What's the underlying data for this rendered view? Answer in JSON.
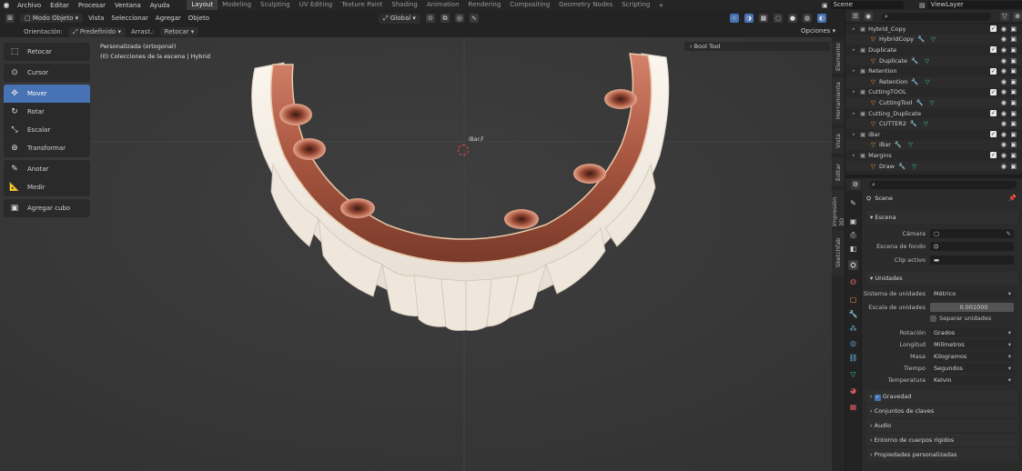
{
  "topbar": {
    "menus": [
      "Archivo",
      "Editar",
      "Procesar",
      "Ventana",
      "Ayuda"
    ],
    "workspaces": [
      "Layout",
      "Modeling",
      "Sculpting",
      "UV Editing",
      "Texture Paint",
      "Shading",
      "Animation",
      "Rendering",
      "Compositing",
      "Geometry Nodes",
      "Scripting"
    ],
    "active_workspace": "Layout",
    "scene_label": "Scene",
    "viewlayer_label": "ViewLayer"
  },
  "viewport_header": {
    "mode": "Modo Objeto",
    "menus": [
      "Vista",
      "Seleccionar",
      "Agregar",
      "Objeto"
    ],
    "transform_orientation": "Global",
    "options_label": "Opciones"
  },
  "tool_settings": {
    "orientation_label": "Orientación:",
    "orientation_value": "Predefinido",
    "drag_label": "Arrast.:",
    "drag_value": "Retocar"
  },
  "toolbar": [
    {
      "label": "Retocar",
      "icon": "tweak-icon",
      "active": false
    },
    {
      "label": "Cursor",
      "icon": "cursor-icon",
      "active": false
    },
    {
      "label": "Mover",
      "icon": "move-icon",
      "active": true
    },
    {
      "label": "Rotar",
      "icon": "rotate-icon",
      "active": false
    },
    {
      "label": "Escalar",
      "icon": "scale-icon",
      "active": false
    },
    {
      "label": "Transformar",
      "icon": "transform-icon",
      "active": false
    },
    {
      "label": "Anotar",
      "icon": "annotate-icon",
      "active": false
    },
    {
      "label": "Medir",
      "icon": "measure-icon",
      "active": false
    },
    {
      "label": "Agregar cubo",
      "icon": "add-cube-icon",
      "active": false
    }
  ],
  "viewport": {
    "info_line1": "Personalizada (ortogonal)",
    "info_line2": "(0) Colecciones de la escena | Hybrid",
    "panel_label": "Bool Tool",
    "object_label": "iBar.F"
  },
  "side_tabs": [
    "Elemento",
    "Herramienta",
    "Vista",
    "Editar",
    "Impresión 3D",
    "Sketchfab"
  ],
  "outliner": [
    {
      "name": "Hybrid_Copy",
      "type": "object",
      "indent": 1
    },
    {
      "name": "HybridCopy",
      "type": "mesh",
      "indent": 2
    },
    {
      "name": "Duplicate",
      "type": "object",
      "indent": 1
    },
    {
      "name": "Duplicate",
      "type": "mesh",
      "indent": 2
    },
    {
      "name": "Retention",
      "type": "object",
      "indent": 1
    },
    {
      "name": "Retention",
      "type": "mesh",
      "indent": 2
    },
    {
      "name": "CuttingTOOL",
      "type": "object",
      "indent": 1
    },
    {
      "name": "CuttingTool",
      "type": "mesh",
      "indent": 2
    },
    {
      "name": "Cutting_Duplicate",
      "type": "object",
      "indent": 1
    },
    {
      "name": "CUTTER2",
      "type": "mesh",
      "indent": 2
    },
    {
      "name": "iBar",
      "type": "object",
      "indent": 1
    },
    {
      "name": "iBar",
      "type": "mesh",
      "indent": 2
    },
    {
      "name": "Margins",
      "type": "object",
      "indent": 1
    },
    {
      "name": "Draw",
      "type": "mesh",
      "indent": 2
    }
  ],
  "properties": {
    "context": "Scene",
    "scene_section": "Escena",
    "camera_label": "Cámara",
    "background_label": "Escena de fondo",
    "clip_label": "Clip activo",
    "units_section": "Unidades",
    "unit_system_label": "Sistema de unidades",
    "unit_system_value": "Métrico",
    "unit_scale_label": "Escala de unidades",
    "unit_scale_value": "0.001000",
    "separate_units_label": "Separar unidades",
    "rotation_label": "Rotación",
    "rotation_value": "Grados",
    "length_label": "Longitud",
    "length_value": "Milímetros",
    "mass_label": "Masa",
    "mass_value": "Kilogramos",
    "time_label": "Tiempo",
    "time_value": "Segundos",
    "temperature_label": "Temperatura",
    "temperature_value": "Kelvin",
    "gravity_label": "Gravedad",
    "keying_sets_label": "Conjuntos de claves",
    "audio_label": "Audio",
    "rigid_body_label": "Entorno de cuerpos rígidos",
    "custom_props_label": "Propiedades personalizadas"
  },
  "colors": {
    "accent": "#4772b3",
    "copper": "#b4624a",
    "tooth": "#f2ece4"
  }
}
